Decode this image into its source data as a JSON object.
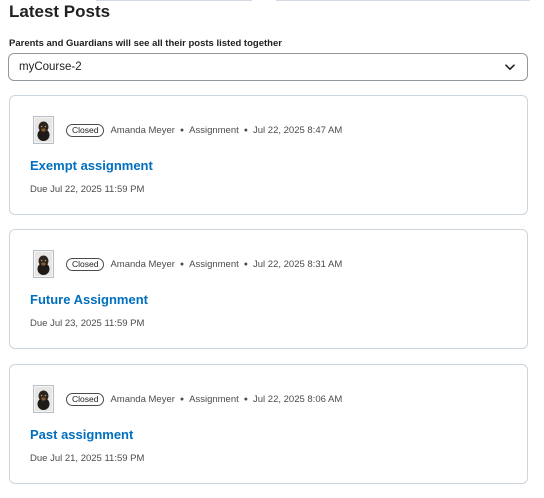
{
  "header": {
    "title": "Latest Posts",
    "subtitle": "Parents and Guardians will see all their posts listed together"
  },
  "course_select": {
    "value": "myCourse-2",
    "icon": "chevron-down-icon"
  },
  "posts": [
    {
      "status": "Closed",
      "author": "Amanda Meyer",
      "type": "Assignment",
      "posted": "Jul 22, 2025 8:47 AM",
      "title": "Exempt assignment",
      "due": "Due Jul 22, 2025 11:59 PM"
    },
    {
      "status": "Closed",
      "author": "Amanda Meyer",
      "type": "Assignment",
      "posted": "Jul 22, 2025 8:31 AM",
      "title": "Future Assignment",
      "due": "Due Jul 23, 2025 11:59 PM"
    },
    {
      "status": "Closed",
      "author": "Amanda Meyer",
      "type": "Assignment",
      "posted": "Jul 22, 2025 8:06 AM",
      "title": "Past assignment",
      "due": "Due Jul 21, 2025 11:59 PM"
    }
  ],
  "colors": {
    "link": "#006fbf",
    "text": "#202122",
    "muted": "#494c4e",
    "border": "#cdd5dc"
  }
}
